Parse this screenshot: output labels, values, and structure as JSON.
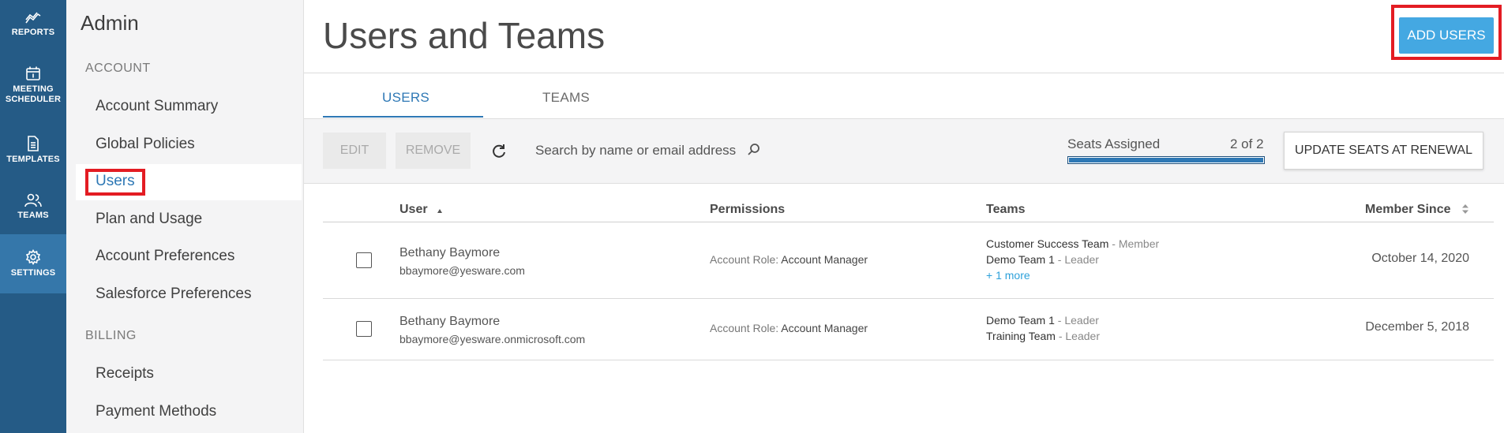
{
  "rail": {
    "items": [
      {
        "label": "REPORTS",
        "icon": "chart-line-icon"
      },
      {
        "label": "MEETING\nSCHEDULER",
        "icon": "calendar-icon"
      },
      {
        "label": "TEMPLATES",
        "icon": "document-icon"
      },
      {
        "label": "TEAMS",
        "icon": "people-icon"
      },
      {
        "label": "SETTINGS",
        "icon": "gear-icon",
        "active": true
      }
    ],
    "colors": {
      "background": "#255b86",
      "active": "#3577aa"
    }
  },
  "sidebar": {
    "title": "Admin",
    "sections": [
      {
        "heading": "ACCOUNT",
        "items": [
          "Account Summary",
          "Global Policies",
          "Users",
          "Plan and Usage",
          "Account Preferences",
          "Salesforce Preferences"
        ]
      },
      {
        "heading": "BILLING",
        "items": [
          "Receipts",
          "Payment Methods"
        ]
      }
    ],
    "active_item": "Users"
  },
  "header": {
    "title": "Users and Teams",
    "add_users_label": "ADD USERS"
  },
  "tabs": {
    "users": "USERS",
    "teams": "TEAMS",
    "active": "USERS"
  },
  "toolbar": {
    "edit_label": "EDIT",
    "remove_label": "REMOVE",
    "search_placeholder": "Search by name or email address",
    "seats_label": "Seats Assigned",
    "seats_count": "2 of 2",
    "seats_fraction": 1.0,
    "update_seats_label": "UPDATE SEATS AT RENEWAL"
  },
  "table": {
    "columns": {
      "user": "User",
      "permissions": "Permissions",
      "teams": "Teams",
      "member_since": "Member Since"
    },
    "rows": [
      {
        "name": "Bethany Baymore",
        "email": "bbaymore@yesware.com",
        "permission_label": "Account Role:",
        "permission_value": "Account Manager",
        "teams": [
          {
            "name": "Customer Success Team",
            "role": "Member"
          },
          {
            "name": "Demo Team 1",
            "role": "Leader"
          }
        ],
        "more": "+ 1 more",
        "member_since": "October 14, 2020"
      },
      {
        "name": "Bethany Baymore",
        "email": "bbaymore@yesware.onmicrosoft.com",
        "permission_label": "Account Role:",
        "permission_value": "Account Manager",
        "teams": [
          {
            "name": "Demo Team 1",
            "role": "Leader"
          },
          {
            "name": "Training Team",
            "role": "Leader"
          }
        ],
        "member_since": "December 5, 2018"
      }
    ]
  },
  "colors": {
    "accent": "#2e78b5",
    "button": "#44a8e2",
    "highlight_outline": "#e31c23",
    "link": "#2ea1da"
  }
}
